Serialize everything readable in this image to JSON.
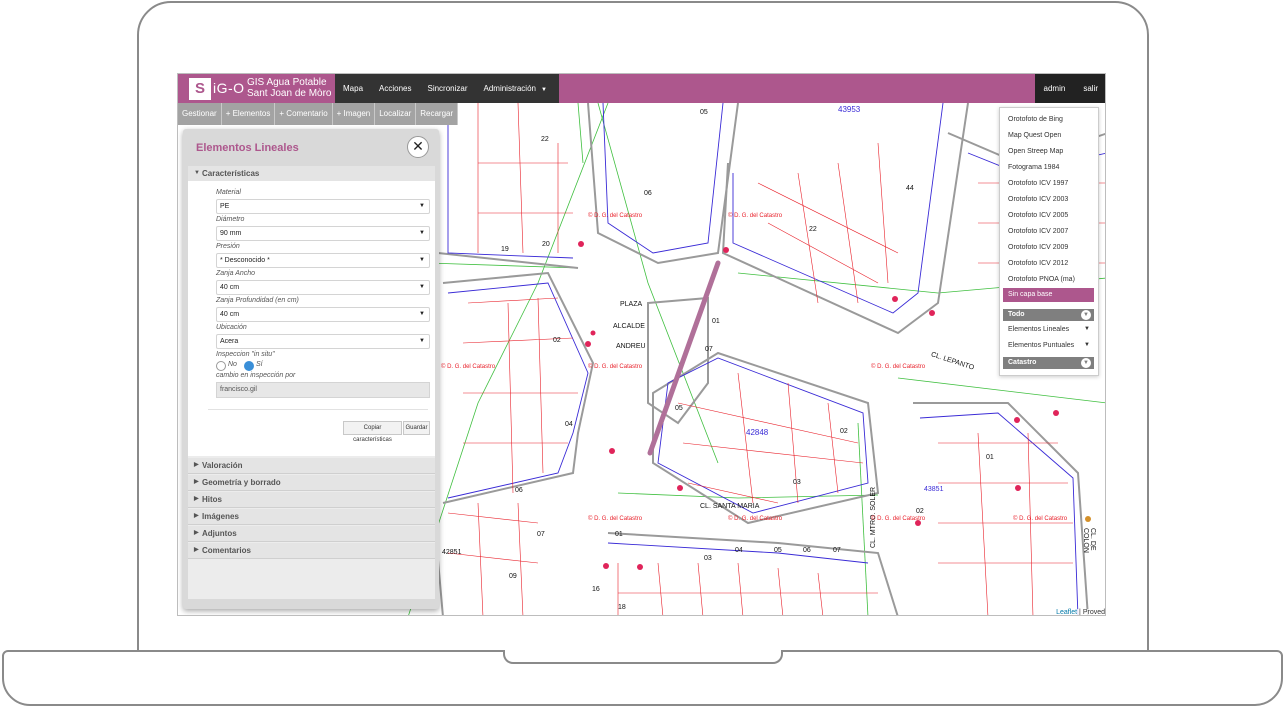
{
  "app": {
    "logo_letters": "S",
    "logo_text": "iG-O",
    "subtitle_line1": "GIS Agua Potable",
    "subtitle_line2": "Sant Joan de Mòro"
  },
  "nav": {
    "items": [
      "Mapa",
      "Acciones",
      "Sincronizar",
      "Administración"
    ],
    "user": "admin",
    "logout": "salir"
  },
  "toolbar": {
    "items": [
      "Gestionar",
      "+ Elementos",
      "+ Comentario",
      "+ Imagen",
      "Localizar",
      "Recargar"
    ]
  },
  "panel": {
    "title": "Elementos Lineales",
    "close": "✕",
    "section_open": "Características",
    "fields": [
      {
        "label": "Material",
        "value": "PE"
      },
      {
        "label": "Diámetro",
        "value": "90 mm"
      },
      {
        "label": "Presión",
        "value": "* Desconocido *"
      },
      {
        "label": "Zanja Ancho",
        "value": "40 cm"
      },
      {
        "label": "Zanja Profundidad (en cm)",
        "value": "40 cm"
      },
      {
        "label": "Ubicación",
        "value": "Acera"
      }
    ],
    "inspection_label": "Inspeccion \"in situ\"",
    "radio_no": "No",
    "radio_si": "Sí",
    "changed_by_label": "cambio en inspección por",
    "changed_by_value": "francisco.gil",
    "copy_button": "Copiar características",
    "save_button": "Guardar",
    "sections": [
      "Valoración",
      "Geometría y borrado",
      "Hitos",
      "Imágenes",
      "Adjuntos",
      "Comentarios"
    ]
  },
  "layers": {
    "base": [
      "Orotofoto de Bing",
      "Map Quest Open",
      "Open Streep Map",
      "Fotograma 1984",
      "Orotofoto ICV 1997",
      "Orotofoto ICV 2003",
      "Orotofoto ICV 2005",
      "Orotofoto ICV 2007",
      "Orotofoto ICV 2009",
      "Orotofoto ICV 2012",
      "Orotofoto PNOA (ma)"
    ],
    "selected": "Sin capa base",
    "group_all": "Todo",
    "sub_lineales": "Elementos Lineales",
    "sub_puntuales": "Elementos Puntuales",
    "group_catastro": "Catastro"
  },
  "map": {
    "streets": [
      "PLAZA",
      "ALCALDE",
      "ANDREU",
      "CL. SANTA MARIA",
      "CL. LEPANTO",
      "CL. MTRO. SOLER",
      "CL. DE COLÓN"
    ],
    "catastro_label": "© D. G. del Catastro",
    "blocks": [
      "42848",
      "43953",
      "43851",
      "42851"
    ],
    "parcel_numbers": [
      "05",
      "22",
      "06",
      "19",
      "20",
      "22",
      "44",
      "02",
      "04",
      "06",
      "07",
      "09",
      "01",
      "07",
      "05",
      "03",
      "02",
      "01",
      "03",
      "04",
      "05",
      "06",
      "07",
      "16",
      "18",
      "01",
      "02",
      "03",
      "04"
    ],
    "attribution_leaflet": "Leaflet",
    "attribution_provider": "Proved"
  },
  "colors": {
    "brand": "#ad578d",
    "nav_dark": "#333333",
    "parcel_red": "#e8202a",
    "block_blue": "#3a2bd6",
    "road_green": "#3fbf3f"
  }
}
